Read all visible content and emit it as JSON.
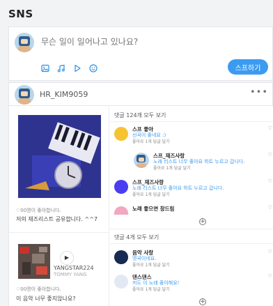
{
  "page": {
    "title": "SNS"
  },
  "composer": {
    "placeholder": "무슨 일이 일어나고 있나요?",
    "share_label": "스프하기"
  },
  "post": {
    "username": "HR_KIM9059",
    "more_label": "•••",
    "card1": {
      "likes": "♡00명이 좋아합니다.",
      "caption": "저의 재즈리스트 공유합니다. ^^7"
    },
    "card2": {
      "artist": "YANGSTAR224",
      "artist_sub": "TOMMY YANG",
      "likes": "♡00명이 좋아합니다.",
      "caption": "이 음악 너무 좋지않나요?"
    }
  },
  "comments1": {
    "header": "댓글 124개 모두 보기",
    "items": [
      {
        "name": "스프 좋아",
        "text": "선곡이 좋네요 :)",
        "meta": "좋아요 1개    답글 달기",
        "color": "#f6c331"
      },
      {
        "name": "스프_재즈사랑",
        "text": "노래 리스트 너무 좋아요 하트 누르고 갑니다.",
        "meta": "좋아요 1개    답글 달기"
      },
      {
        "name": "스프_재즈사랑",
        "text": "노래 리스트 너무 좋아요 하트 누르고 갑니다.",
        "meta": "좋아요 1개    답글 달기",
        "color": "#4b3df0"
      },
      {
        "name": "노래 좋으면 창드림",
        "color": "#f4a7c0"
      }
    ]
  },
  "comments2": {
    "header": "댓글 4개 모두 보기",
    "items": [
      {
        "name": "음악 사랑",
        "text": "명곡이네요.",
        "meta": "좋아요 1개    답글 달기",
        "color": "#162a52"
      },
      {
        "name": "댄스댄스",
        "text": "저도 이 노래 좋아해요!",
        "meta": "좋아요 1개    답글 달기",
        "color": "#e3e9f4"
      }
    ]
  },
  "icons": {
    "heart": "♡",
    "plus": "+",
    "play": "▶"
  }
}
